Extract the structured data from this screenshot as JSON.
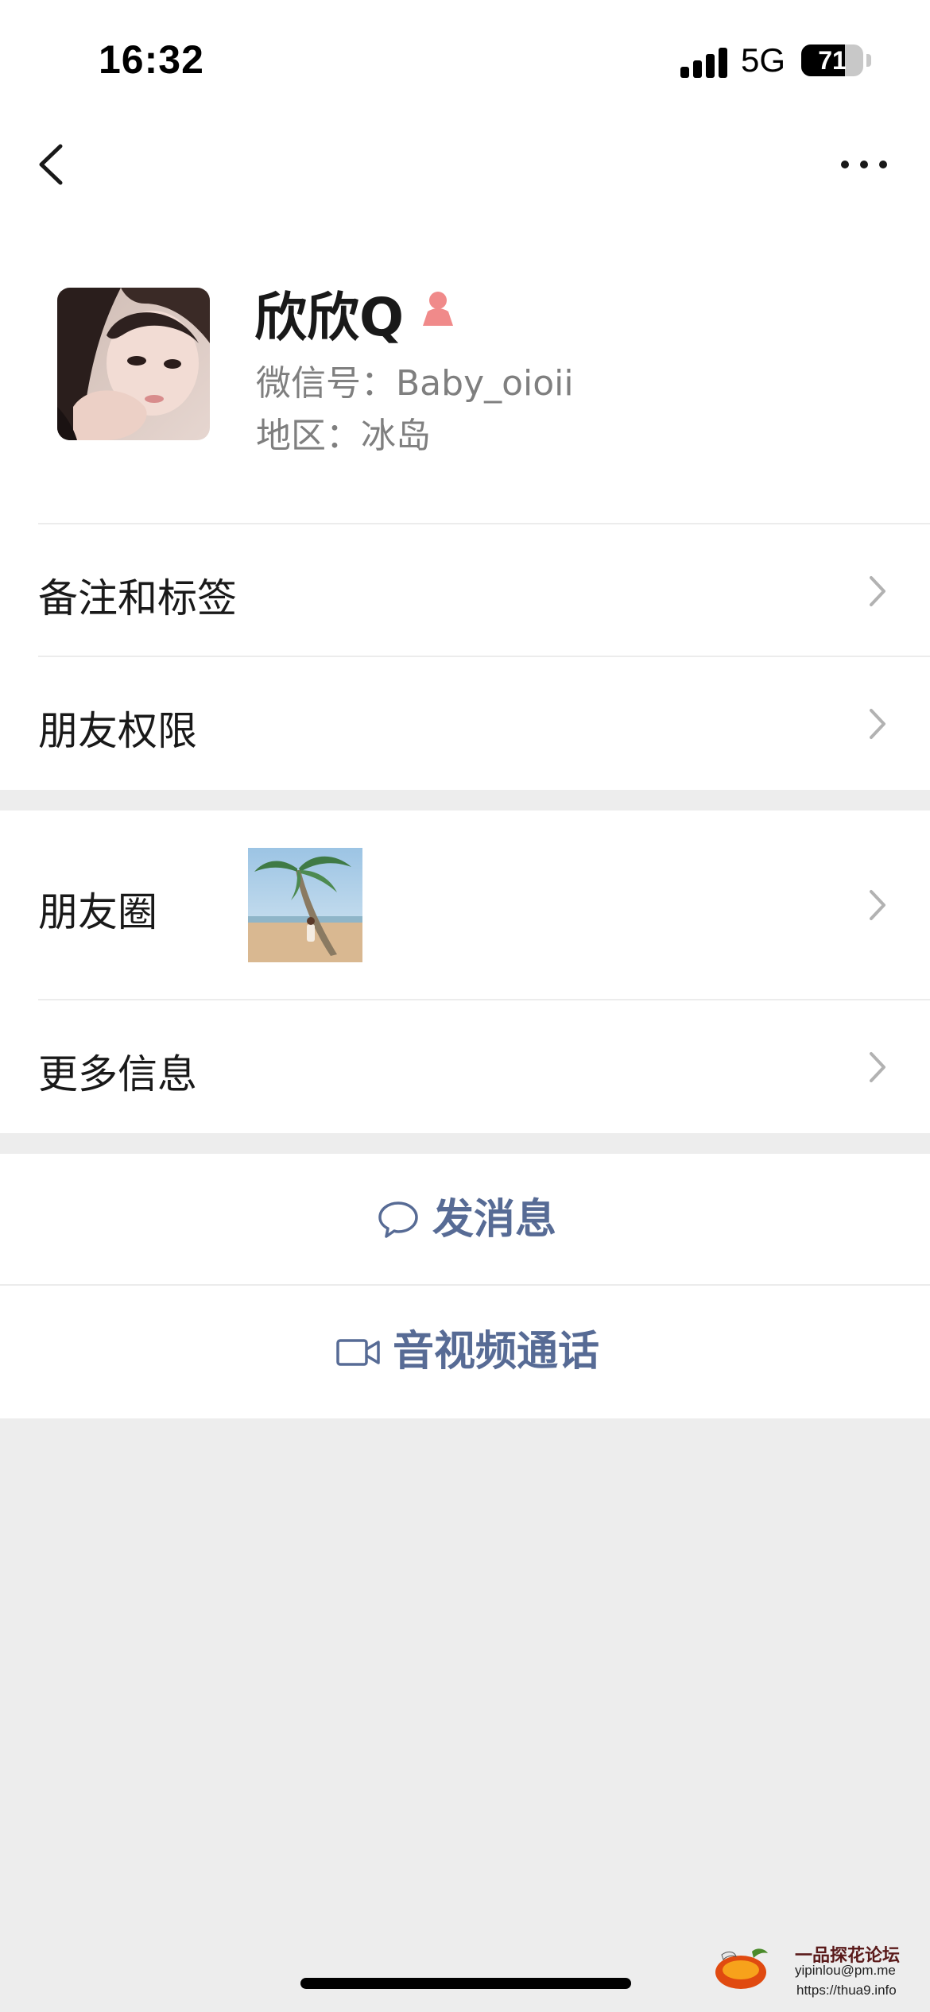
{
  "status_bar": {
    "time": "16:32",
    "network": "5G",
    "battery_percent": 71
  },
  "nav": {
    "back_icon": "chevron-left-icon",
    "more_icon": "more-dots-icon"
  },
  "profile": {
    "name": "欣欣Q",
    "gender_icon": "female-icon",
    "gender_color": "#fa5151",
    "wechat_id": "微信号：Baby_oioii",
    "region": "地区：冰岛"
  },
  "menu": {
    "remarks_tags": "备注和标签",
    "friend_permissions": "朋友权限",
    "moments": "朋友圈",
    "more_info": "更多信息"
  },
  "actions": {
    "send_message": "发消息",
    "video_call": "音视频通话",
    "link_color": "#576b95"
  },
  "watermark": {
    "title": "一品探花论坛",
    "email": "yipinlou@pm.me",
    "url": "https://thua9.info"
  }
}
